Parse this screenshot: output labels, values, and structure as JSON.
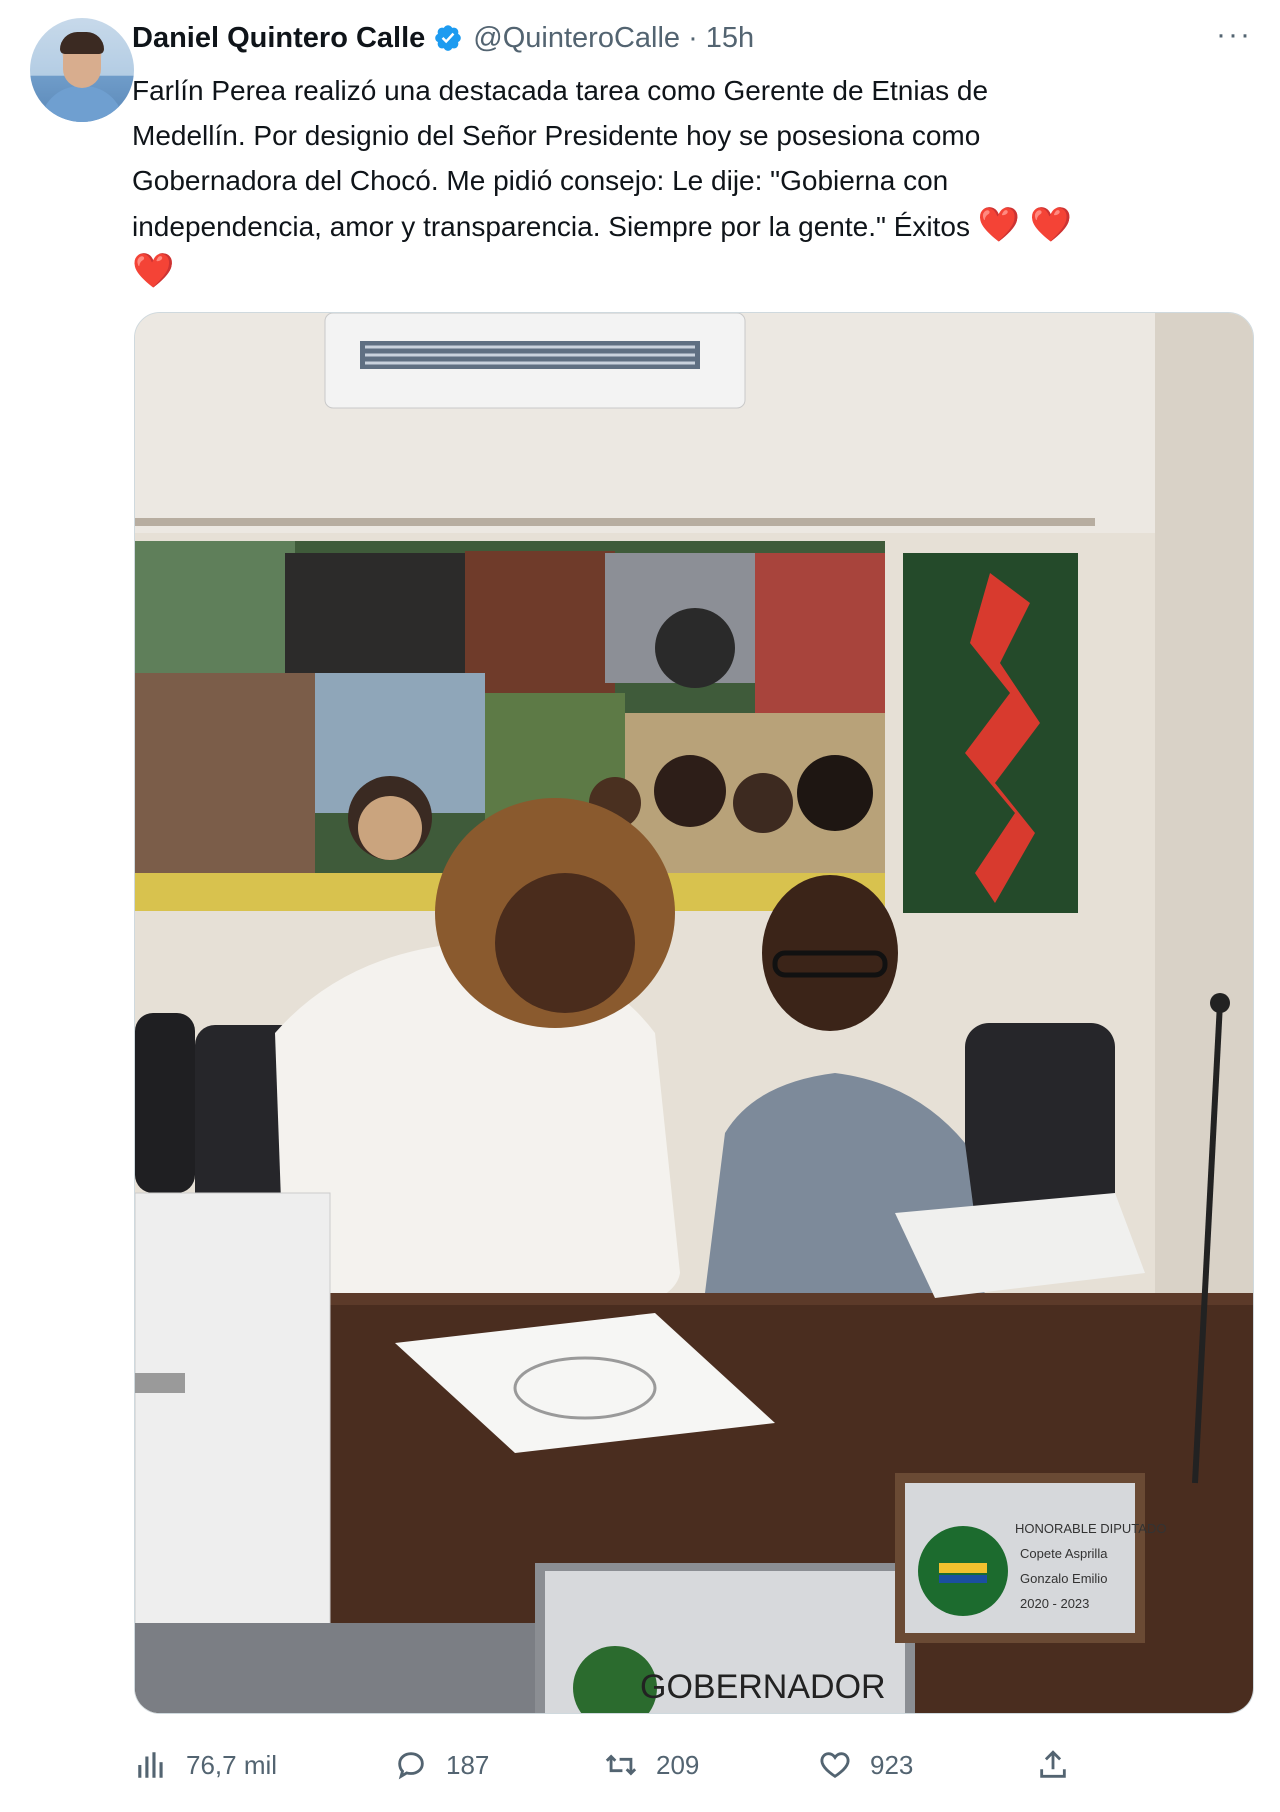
{
  "tweet": {
    "author_name": "Daniel Quintero Calle",
    "author_handle": "@QuinteroCalle",
    "separator": "·",
    "time": "15h",
    "more_label": "···",
    "text_main": "Farlín Perea realizó una destacada tarea como Gerente de Etnias de\nMedellín. Por designio del Señor Presidente hoy se posesiona como\nGobernadora del Chocó. Me pidió consejo: Le dije: \"Gobierna con\nindependencia, amor y transparencia. Siempre por la gente.\" Éxitos ",
    "emoji_hearts": "❤️ ❤️\n❤️"
  },
  "media": {
    "placard_front": "GOBERNADOR",
    "placard_right_lines": [
      "HONORABLE DIPUTADO",
      "Copete Asprilla",
      "Gonzalo Emilio",
      "2020 - 2023"
    ]
  },
  "actions": {
    "views": "76,7 mil",
    "replies": "187",
    "retweets": "209",
    "likes": "923"
  },
  "icons": {
    "verified": "verified-badge-icon",
    "views": "bar-chart-icon",
    "reply": "speech-bubble-icon",
    "retweet": "retweet-arrows-icon",
    "like": "heart-outline-icon",
    "share": "share-upload-icon"
  },
  "colors": {
    "verified": "#1d9bf0",
    "muted_text": "#536471",
    "heart": "#e0245e"
  }
}
